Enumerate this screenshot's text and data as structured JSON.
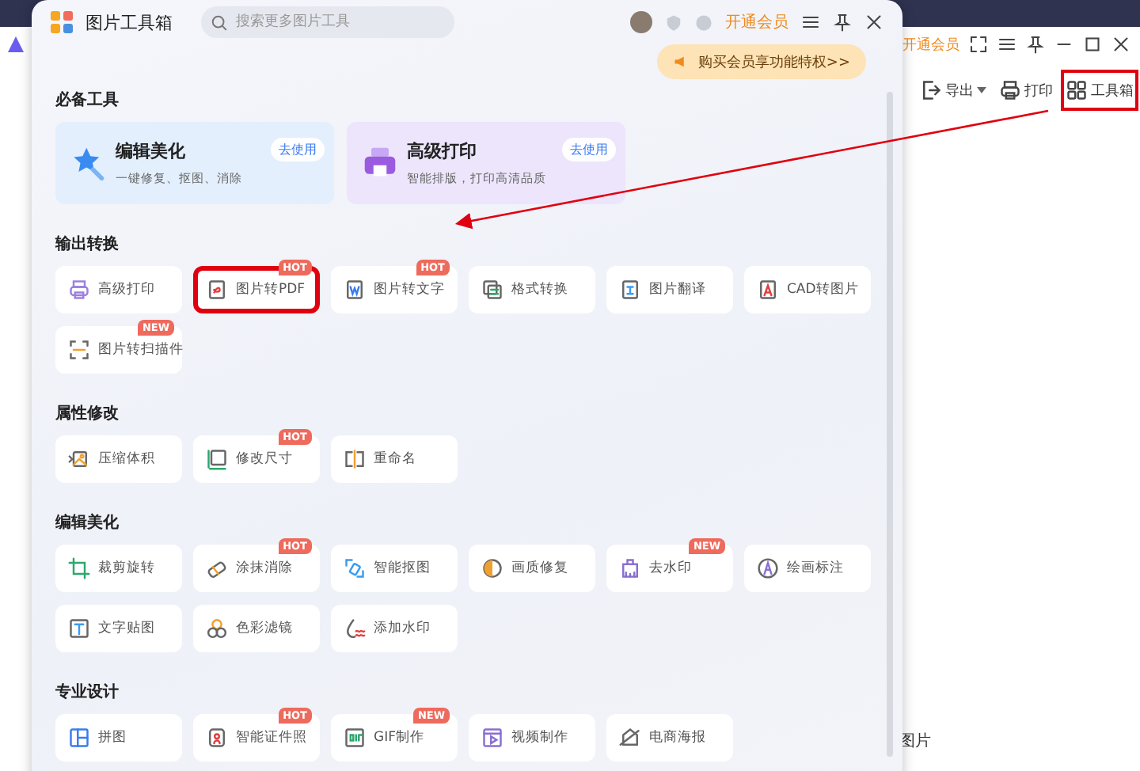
{
  "background_app": {
    "vip_link": "开通会员",
    "toolbar": [
      {
        "label": "导出",
        "kind": "export",
        "has_menu": true,
        "highlighted": false
      },
      {
        "label": "打印",
        "kind": "print",
        "has_menu": false,
        "highlighted": false
      },
      {
        "label": "工具箱",
        "kind": "toolbox",
        "has_menu": false,
        "highlighted": true
      }
    ],
    "partial_text": "图片"
  },
  "popup": {
    "title": "图片工具箱",
    "search": {
      "placeholder": "搜索更多图片工具"
    },
    "vip_link": "开通会员",
    "promo_banner": "购买会员享功能特权>>",
    "sections": [
      {
        "title": "必备工具",
        "kind": "featured",
        "items": [
          {
            "label": "编辑美化",
            "description": "一键修复、抠图、消除",
            "action": "去使用"
          },
          {
            "label": "高级打印",
            "description": "智能排版，打印高清品质",
            "action": "去使用"
          }
        ]
      },
      {
        "title": "输出转换",
        "kind": "grid",
        "items": [
          {
            "label": "高级打印",
            "highlighted": false
          },
          {
            "label": "图片转PDF",
            "badge": "HOT",
            "highlighted": true
          },
          {
            "label": "图片转文字",
            "badge": "HOT",
            "highlighted": false
          },
          {
            "label": "格式转换",
            "highlighted": false
          },
          {
            "label": "图片翻译",
            "highlighted": false
          },
          {
            "label": "CAD转图片",
            "highlighted": false
          },
          {
            "label": "图片转扫描件",
            "badge": "NEW",
            "highlighted": false
          }
        ]
      },
      {
        "title": "属性修改",
        "kind": "grid",
        "items": [
          {
            "label": "压缩体积",
            "highlighted": false
          },
          {
            "label": "修改尺寸",
            "badge": "HOT",
            "highlighted": false
          },
          {
            "label": "重命名",
            "highlighted": false
          }
        ]
      },
      {
        "title": "编辑美化",
        "kind": "grid",
        "items": [
          {
            "label": "裁剪旋转",
            "highlighted": false
          },
          {
            "label": "涂抹消除",
            "badge": "HOT",
            "highlighted": false
          },
          {
            "label": "智能抠图",
            "highlighted": false
          },
          {
            "label": "画质修复",
            "highlighted": false
          },
          {
            "label": "去水印",
            "badge": "NEW",
            "highlighted": false
          },
          {
            "label": "绘画标注",
            "highlighted": false
          },
          {
            "label": "文字贴图",
            "highlighted": false
          },
          {
            "label": "色彩滤镜",
            "highlighted": false
          },
          {
            "label": "添加水印",
            "highlighted": false
          }
        ]
      },
      {
        "title": "专业设计",
        "kind": "grid",
        "items": [
          {
            "label": "拼图",
            "highlighted": false
          },
          {
            "label": "智能证件照",
            "badge": "HOT",
            "highlighted": false
          },
          {
            "label": "GIF制作",
            "badge": "NEW",
            "highlighted": false
          },
          {
            "label": "视频制作",
            "highlighted": false
          },
          {
            "label": "电商海报",
            "highlighted": false
          }
        ]
      }
    ]
  }
}
